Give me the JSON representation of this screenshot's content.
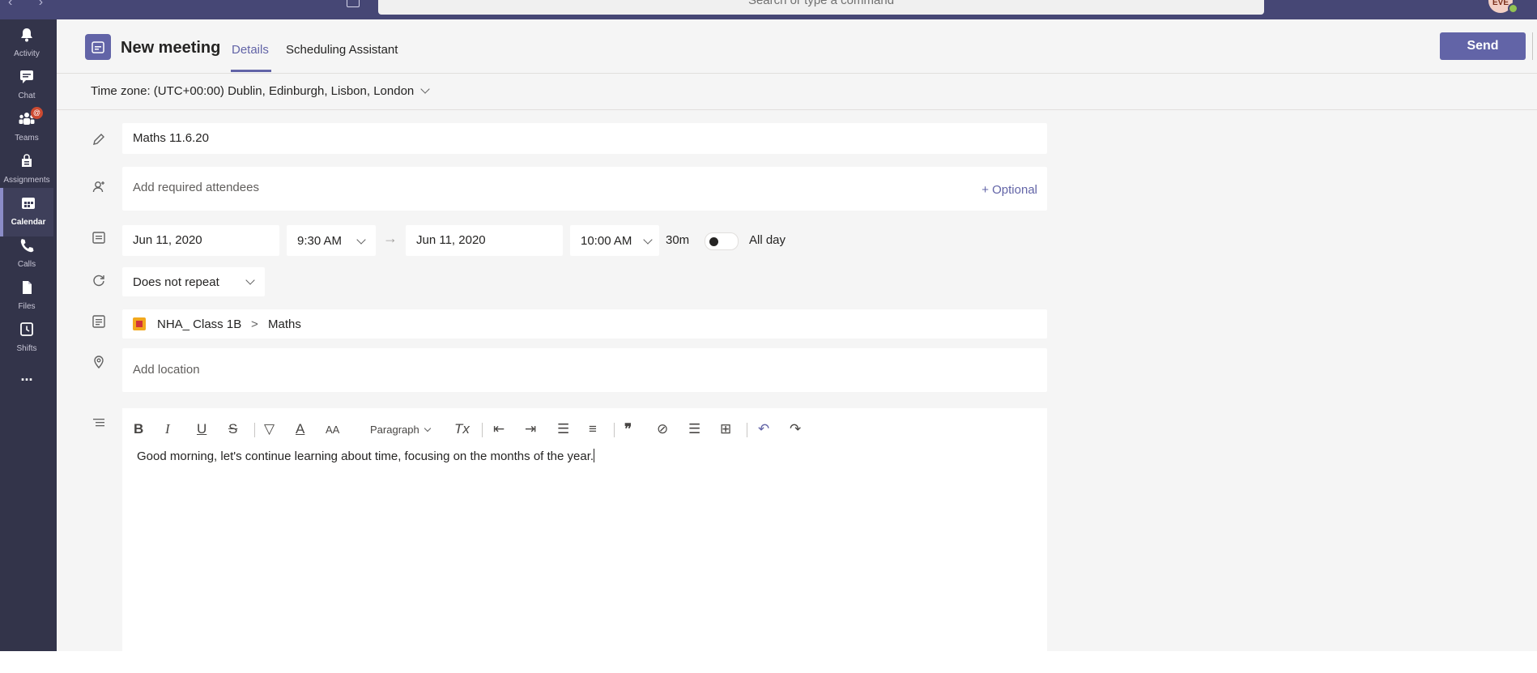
{
  "topbar": {
    "nav": "‹ ›",
    "search_placeholder": "Search or type a command",
    "avatar_initials": "EVE"
  },
  "rail": [
    {
      "label": "Activity",
      "icon": "bell-icon"
    },
    {
      "label": "Chat",
      "icon": "chat-icon"
    },
    {
      "label": "Teams",
      "icon": "teams-icon",
      "badge": "@"
    },
    {
      "label": "Assignments",
      "icon": "assignments-icon"
    },
    {
      "label": "Calendar",
      "icon": "calendar-icon",
      "active": true
    },
    {
      "label": "Calls",
      "icon": "phone-icon"
    },
    {
      "label": "Files",
      "icon": "file-icon"
    },
    {
      "label": "Shifts",
      "icon": "clock-icon"
    },
    {
      "label": "...",
      "icon": "more-icon"
    }
  ],
  "header": {
    "title": "New meeting",
    "tabs": [
      "Details",
      "Scheduling Assistant"
    ],
    "send_label": "Send"
  },
  "timezone": "Time zone: (UTC+00:00) Dublin, Edinburgh, Lisbon, London",
  "form": {
    "title_value": "Maths   11.6.20",
    "attendees_placeholder": "Add required attendees",
    "optional_label": "+ Optional",
    "start_date": "Jun 11, 2020",
    "start_time": "9:30 AM",
    "end_date": "Jun 11, 2020",
    "end_time": "10:00 AM",
    "duration": "30m",
    "all_day_label": "All day",
    "repeat": "Does not repeat",
    "channel_team": "NHA_ Class 1B",
    "channel_separator": ">",
    "channel_name": "Maths",
    "location_placeholder": "Add location"
  },
  "editor": {
    "toolbar": [
      "B",
      "I",
      "U",
      "S",
      "highlight-icon",
      "A",
      "AA",
      "Paragraph",
      "Tx",
      "outdent-icon",
      "indent-icon",
      "bullets-icon",
      "numbering-icon",
      "quote-icon",
      "link-icon",
      "divider-icon",
      "table-icon",
      "undo-icon",
      "redo-icon"
    ],
    "paragraph_label": "Paragraph",
    "body": "Good morning, let's continue learning about time, focusing on the months of the year."
  },
  "colors": {
    "accent": "#6264a7",
    "rail": "#33344a",
    "topbar": "#464775"
  }
}
